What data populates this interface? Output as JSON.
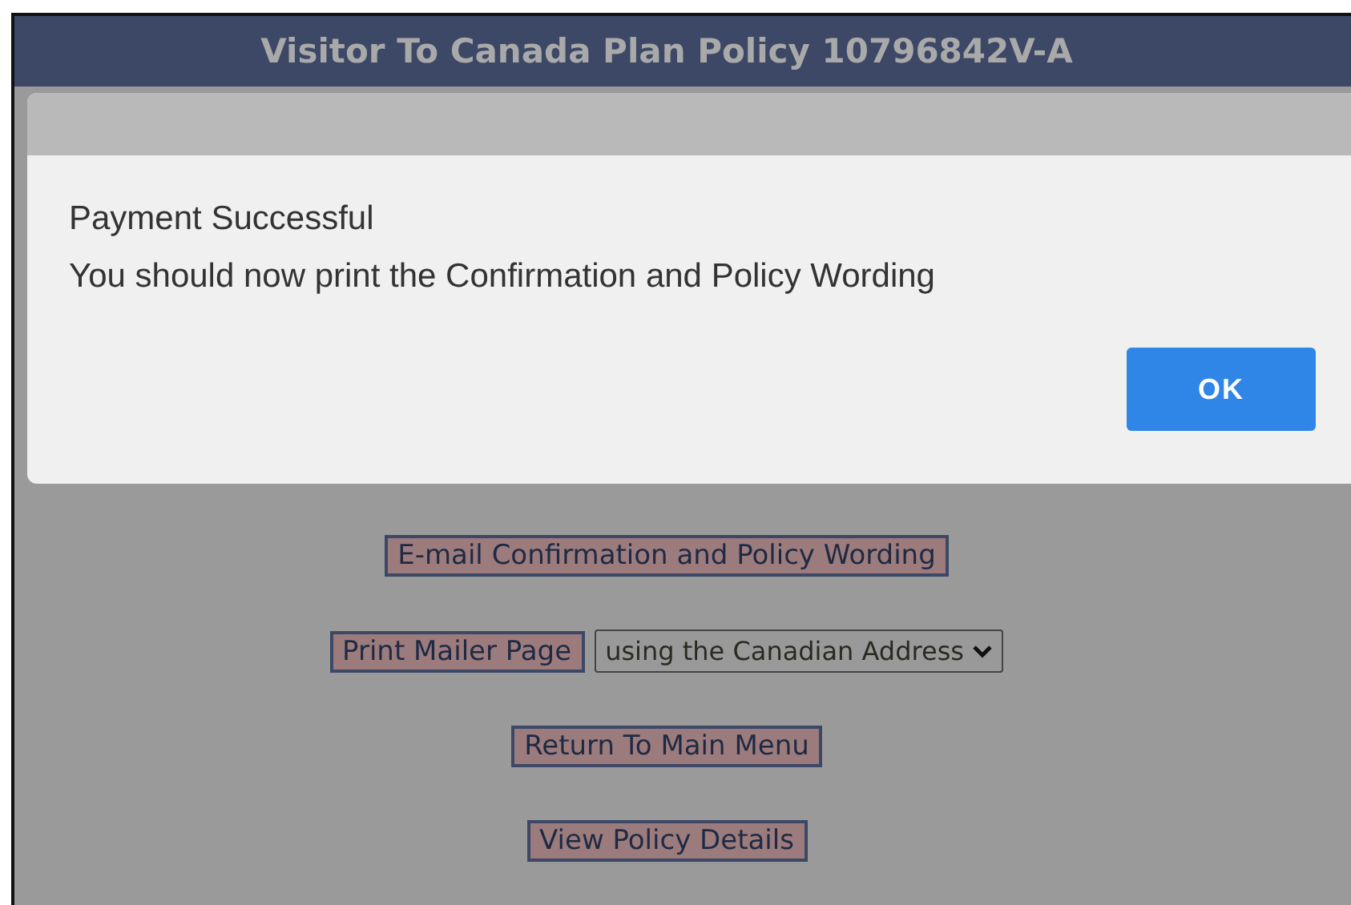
{
  "header": {
    "title": "Visitor To Canada Plan Policy 10796842V-A"
  },
  "dialog": {
    "lines": [
      "Payment Successful",
      "You should now print the Confirmation and Policy Wording"
    ],
    "button": "OK"
  },
  "actions": [
    {
      "kind": "button",
      "label": "E-mail Confirmation and Policy Wording"
    },
    {
      "kind": "button-with-select",
      "label": "Print Mailer Page",
      "select": "using the Canadian Address"
    },
    {
      "kind": "button",
      "label": "Return To Main Menu"
    },
    {
      "kind": "button",
      "label": "View Policy Details"
    }
  ]
}
